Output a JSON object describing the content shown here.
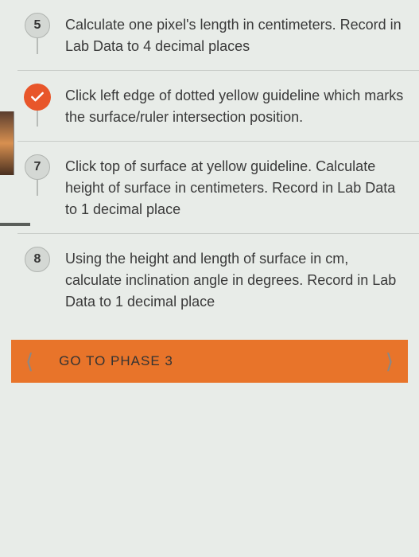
{
  "steps": [
    {
      "marker_type": "number",
      "marker_value": "5",
      "text": "Calculate one pixel's length in centimeters. Record in Lab Data to 4 decimal places"
    },
    {
      "marker_type": "check",
      "marker_value": "",
      "text": "Click left edge of dotted yellow guideline which marks the surface/ruler intersection position."
    },
    {
      "marker_type": "number",
      "marker_value": "7",
      "text": "Click top of surface at yellow guideline. Calculate height of surface in centimeters. Record in Lab Data to 1 decimal place"
    },
    {
      "marker_type": "number",
      "marker_value": "8",
      "text": "Using the height and length of surface in cm, calculate inclination angle in degrees. Record in Lab Data to 1 decimal place"
    }
  ],
  "footer": {
    "label": "GO TO PHASE 3"
  }
}
